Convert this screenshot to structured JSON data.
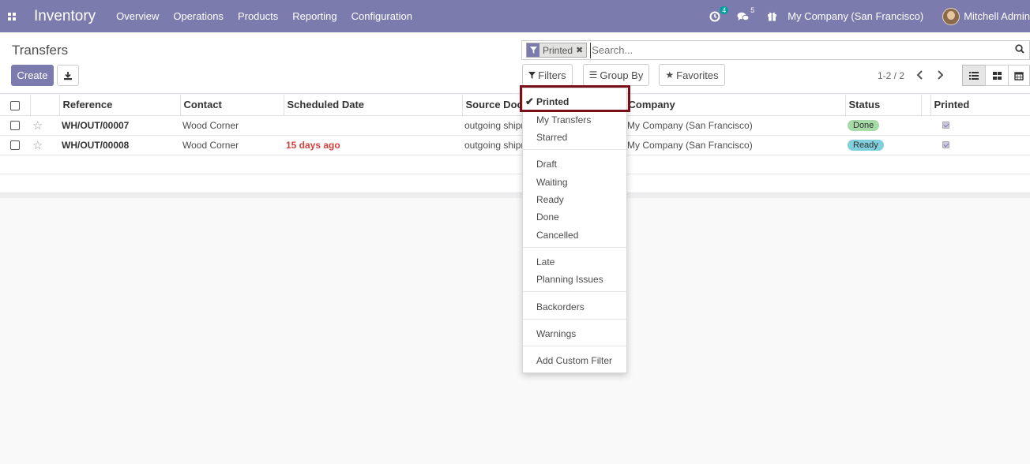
{
  "navbar": {
    "app_title": "Inventory",
    "menu": [
      "Overview",
      "Operations",
      "Products",
      "Reporting",
      "Configuration"
    ],
    "activity_count": "4",
    "messages_count": "5",
    "company": "My Company (San Francisco)",
    "user": "Mitchell Admin",
    "accent": "#7c7bad"
  },
  "control_panel": {
    "title": "Transfers",
    "create_label": "Create",
    "search": {
      "facet_value": "Printed",
      "placeholder": "Search..."
    },
    "filters_label": "Filters",
    "group_by_label": "Group By",
    "favorites_label": "Favorites",
    "pager": "1-2 / 2"
  },
  "table": {
    "columns": [
      "Reference",
      "Contact",
      "Scheduled Date",
      "Source Docu",
      "Company",
      "Status",
      "Printed"
    ],
    "rows": [
      {
        "reference": "WH/OUT/00007",
        "contact": "Wood Corner",
        "scheduled_date": "",
        "source": "outgoing shipr",
        "company": "My Company (San Francisco)",
        "status": "Done",
        "status_color": "#a6dba8"
      },
      {
        "reference": "WH/OUT/00008",
        "contact": "Wood Corner",
        "scheduled_date": "15 days ago",
        "source": "outgoing shipr",
        "company": "My Company (San Francisco)",
        "status": "Ready",
        "status_color": "#7fcfdc"
      }
    ]
  },
  "filters_dropdown": {
    "items": [
      "Printed",
      "My Transfers",
      "Starred",
      "Draft",
      "Waiting",
      "Ready",
      "Done",
      "Cancelled",
      "Late",
      "Planning Issues",
      "Backorders",
      "Warnings",
      "Add Custom Filter"
    ],
    "selected": "Printed",
    "highlight_color": "#7a1017"
  }
}
